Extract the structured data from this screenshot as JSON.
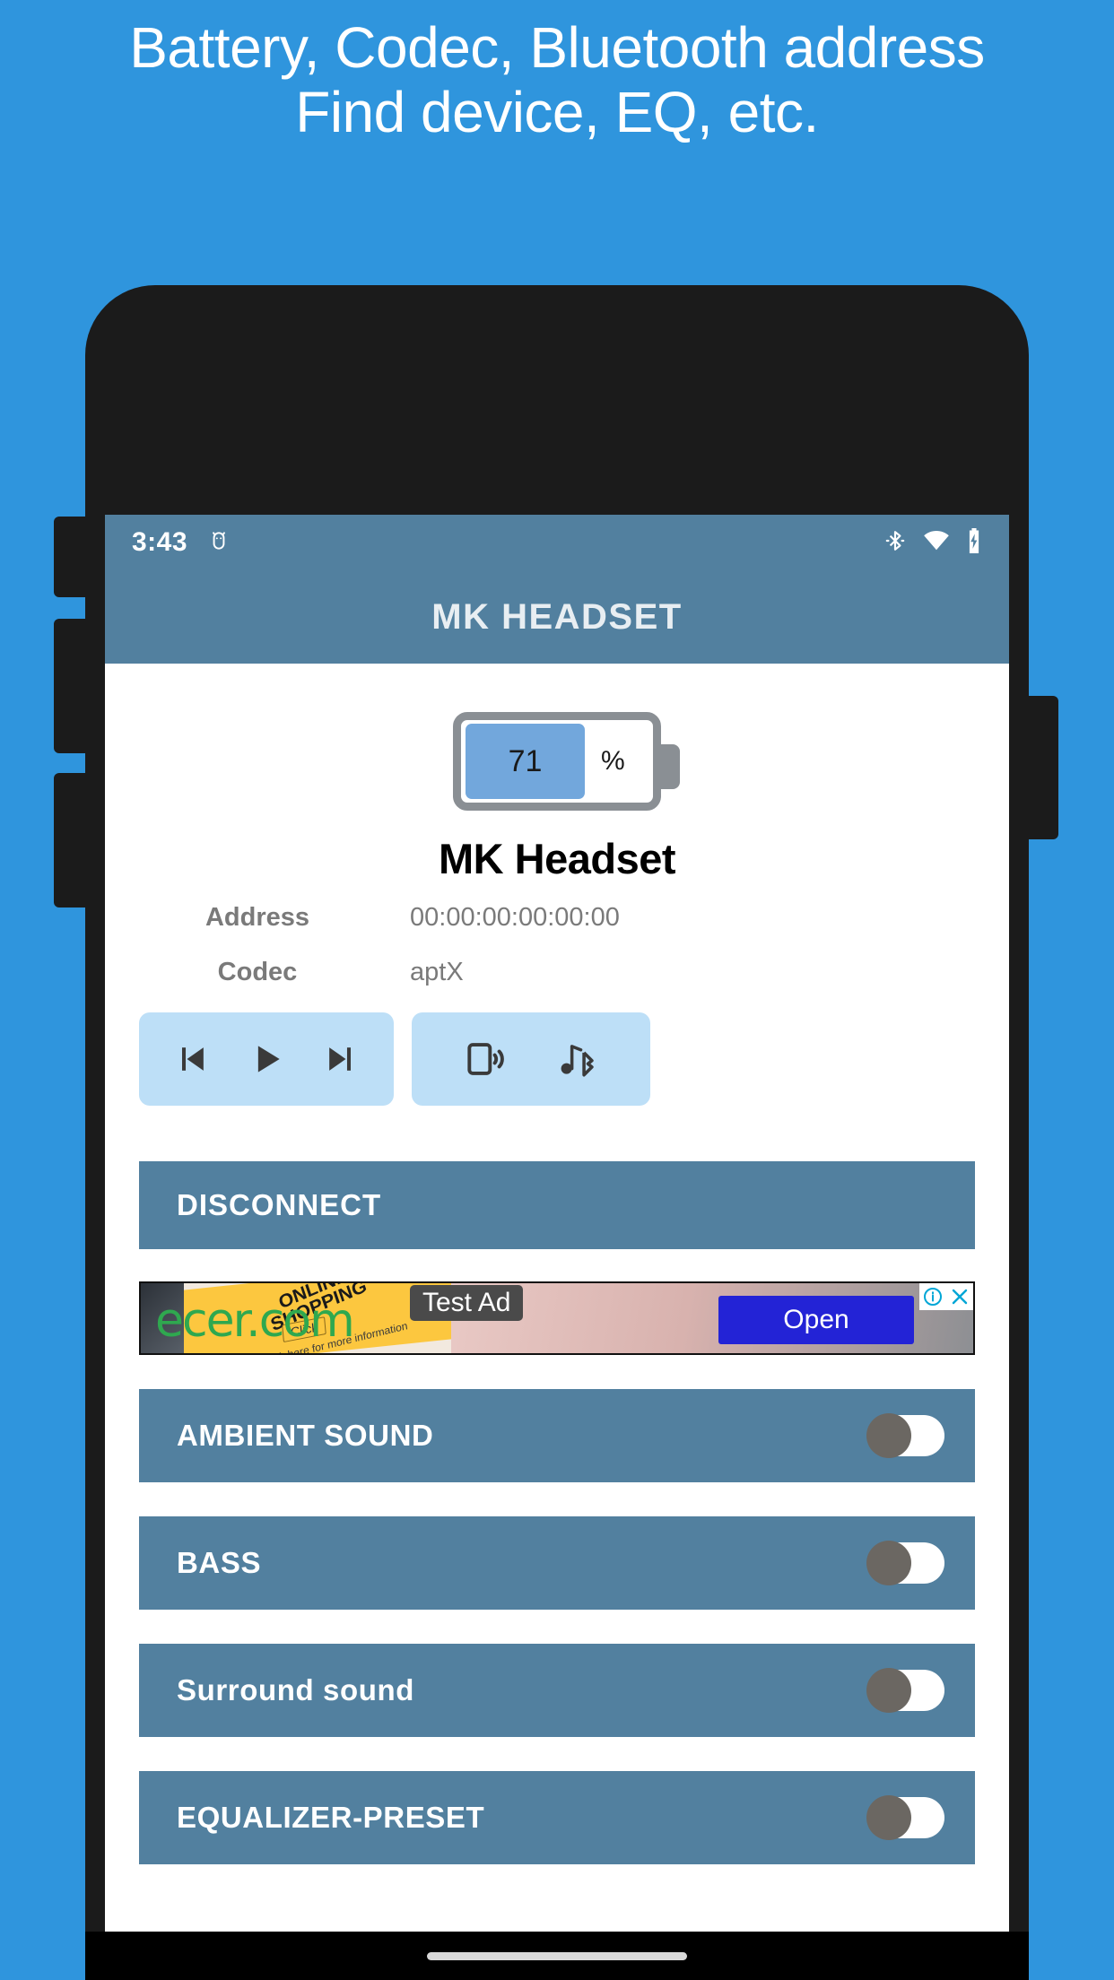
{
  "promo": {
    "line1": "Battery, Codec, Bluetooth address",
    "line2": "Find device, EQ, etc."
  },
  "status_bar": {
    "time": "3:43",
    "left_icons": [
      "android-debug-icon"
    ],
    "right_icons": [
      "bluetooth-icon",
      "wifi-icon",
      "battery-charging-icon"
    ]
  },
  "app_bar": {
    "title": "MK HEADSET"
  },
  "battery": {
    "percent": "71",
    "symbol": "%",
    "fill_color": "#72a7dc",
    "outline_color": "#8a8f94"
  },
  "device": {
    "name": "MK Headset",
    "rows": [
      {
        "label": "Address",
        "value": "00:00:00:00:00:00"
      },
      {
        "label": "Codec",
        "value": "aptX"
      }
    ]
  },
  "media_panel": {
    "buttons": [
      {
        "name": "previous-track-button",
        "icon": "skip-previous-icon"
      },
      {
        "name": "play-button",
        "icon": "play-icon"
      },
      {
        "name": "next-track-button",
        "icon": "skip-next-icon"
      }
    ]
  },
  "extra_panel": {
    "buttons": [
      {
        "name": "find-device-button",
        "icon": "phone-ring-icon"
      },
      {
        "name": "bluetooth-audio-button",
        "icon": "music-bluetooth-icon"
      }
    ]
  },
  "disconnect": {
    "label": "DISCONNECT"
  },
  "ad": {
    "label": "Test Ad",
    "logo": "ecer.com",
    "banner_line1": "ONLINE",
    "banner_line2": "SHOPPING",
    "click_label": "Click",
    "click_info": "Click here for more information",
    "cta": "Open",
    "info_icon": "info-icon",
    "close_icon": "close-icon",
    "cta_color": "#2323d6"
  },
  "toggles": [
    {
      "label": "AMBIENT SOUND",
      "state": "off"
    },
    {
      "label": "BASS",
      "state": "off"
    },
    {
      "label": "Surround sound",
      "state": "off"
    },
    {
      "label": "EQUALIZER-PRESET",
      "state": "off"
    }
  ],
  "theme": {
    "background": "#2f95dd",
    "accent": "#52809f",
    "panel": "#bddff7"
  }
}
